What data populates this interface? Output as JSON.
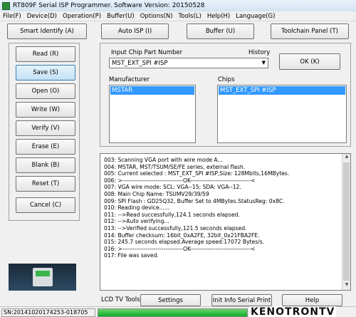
{
  "window": {
    "title": "RT809F Serial ISP Programmer. Software Version: 20150528"
  },
  "menu": [
    "File(F)",
    "Device(D)",
    "Operation(P)",
    "Buffer(U)",
    "Options(N)",
    "Tools(L)",
    "Help(H)",
    "Language(G)"
  ],
  "toolbar": {
    "smart_identify": "Smart Identify (A)",
    "auto_isp": "Auto ISP (I)",
    "buffer": "Buffer (U)",
    "toolchain_panel": "Toolchain Panel (T)"
  },
  "left_buttons": [
    "Read (R)",
    "Save (S)",
    "Open (O)",
    "Write  (W)",
    "Verify (V)",
    "Erase (E)",
    "Blank (B)",
    "Reset  (T)"
  ],
  "cancel_label": "Cancel (C)",
  "chip": {
    "input_label": "Input Chip Part Number",
    "history_label": "History",
    "value": "MST_EXT_SPI #ISP",
    "ok_label": "OK (K)",
    "manufacturer_label": "Manufacturer",
    "manufacturer_selected": "MSTAR",
    "chips_label": "Chips",
    "chips_selected": "MST_EXT_SPI #ISP"
  },
  "log": [
    "003:  Scanning VGA port with wire mode A...",
    "004:  MSTAR, MST/TSUM/SE/FE series, external flash.",
    "005:  Current selected : MST_EXT_SPI #ISP,Size: 128Mbits,16MBytes.",
    "006:  >-------------------------------OK-------------------------------<",
    "007:  VGA wire mode: SCL: VGA--15; SDA: VGA--12.",
    "008:  Main Chip Name: TSUMV29/39/59",
    "009:  SPI Flash : GD25Q32, Buffer Set to 4MBytes.StatusReg: 0x8C.",
    "010:  Reading device......",
    "011:  -->Read successfully,124.1 seconds elapsed.",
    "012:  -->Auto verifying...",
    "013:  -->Verified successfully,121.5 seconds elapsed.",
    "014:  Buffer checksum: 16bit_0xA2FE, 32bit_0x21FBA2FE.",
    "015:  245.7 seconds elapsed.Average speed:17072 Bytes/s.",
    "016:  >-------------------------------OK-------------------------------<",
    "017:  File was saved."
  ],
  "lcd": {
    "label": "LCD TV Tools:",
    "settings": "Settings",
    "init_info": "Init Info Serial Print",
    "help": "Help"
  },
  "status": {
    "sn": "SN:20141020174253-018705",
    "progress": 1.0
  },
  "watermark": "KENOTRONTV"
}
